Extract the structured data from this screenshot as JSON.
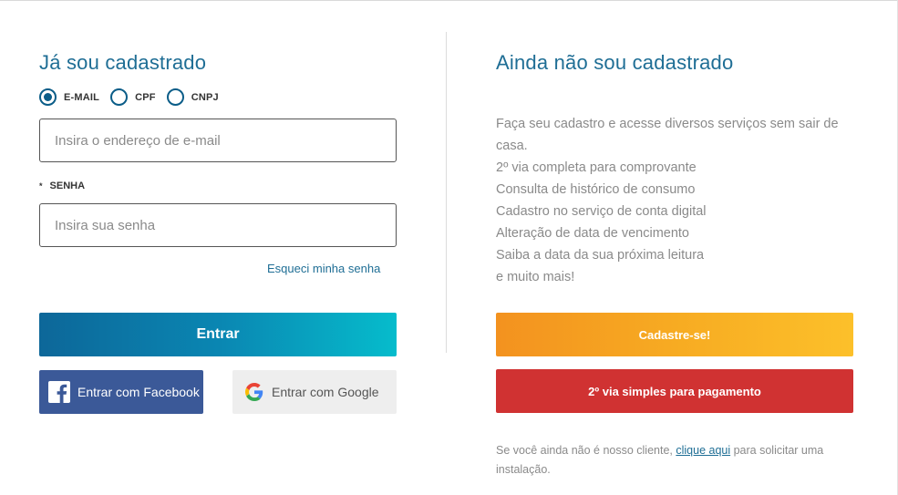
{
  "left": {
    "title": "Já sou cadastrado",
    "login_type": {
      "options": [
        {
          "label": "E-MAIL",
          "checked": true
        },
        {
          "label": "CPF",
          "checked": false
        },
        {
          "label": "CNPJ",
          "checked": false
        }
      ]
    },
    "email": {
      "value": "",
      "placeholder": "Insira o endereço de e-mail"
    },
    "password": {
      "label": "SENHA",
      "required_mark": "*",
      "value": "",
      "placeholder": "Insira sua senha"
    },
    "forgot_label": "Esqueci minha senha",
    "login_button": "Entrar",
    "facebook_button": "Entrar com Facebook",
    "google_button": "Entrar com Google"
  },
  "right": {
    "title": "Ainda não sou cadastrado",
    "description_lines": [
      "Faça seu cadastro e acesse diversos serviços sem sair de casa.",
      "2º via completa para comprovante",
      "Consulta de histórico de consumo",
      "Cadastro no serviço de conta digital",
      "Alteração de data de vencimento",
      "Saiba a data da sua próxima leitura",
      "e muito mais!"
    ],
    "register_button": "Cadastre-se!",
    "second_copy_button": "2º via simples para pagamento",
    "footer": {
      "before": "Se você ainda não é nosso cliente, ",
      "link": "clique aqui",
      "after": " para solicitar uma instalação."
    }
  },
  "colors": {
    "title": "#1f6e95",
    "radio": "#0b5d88",
    "entrar_gradient": [
      "#0d6799",
      "#06bccc"
    ],
    "facebook": "#3b5998",
    "google_bg": "#eeeeee",
    "cadastre_gradient": [
      "#f3921f",
      "#fcc02a"
    ],
    "segunda_via": "#d03232"
  },
  "icons": {
    "facebook": "facebook-icon",
    "google": "google-icon"
  }
}
